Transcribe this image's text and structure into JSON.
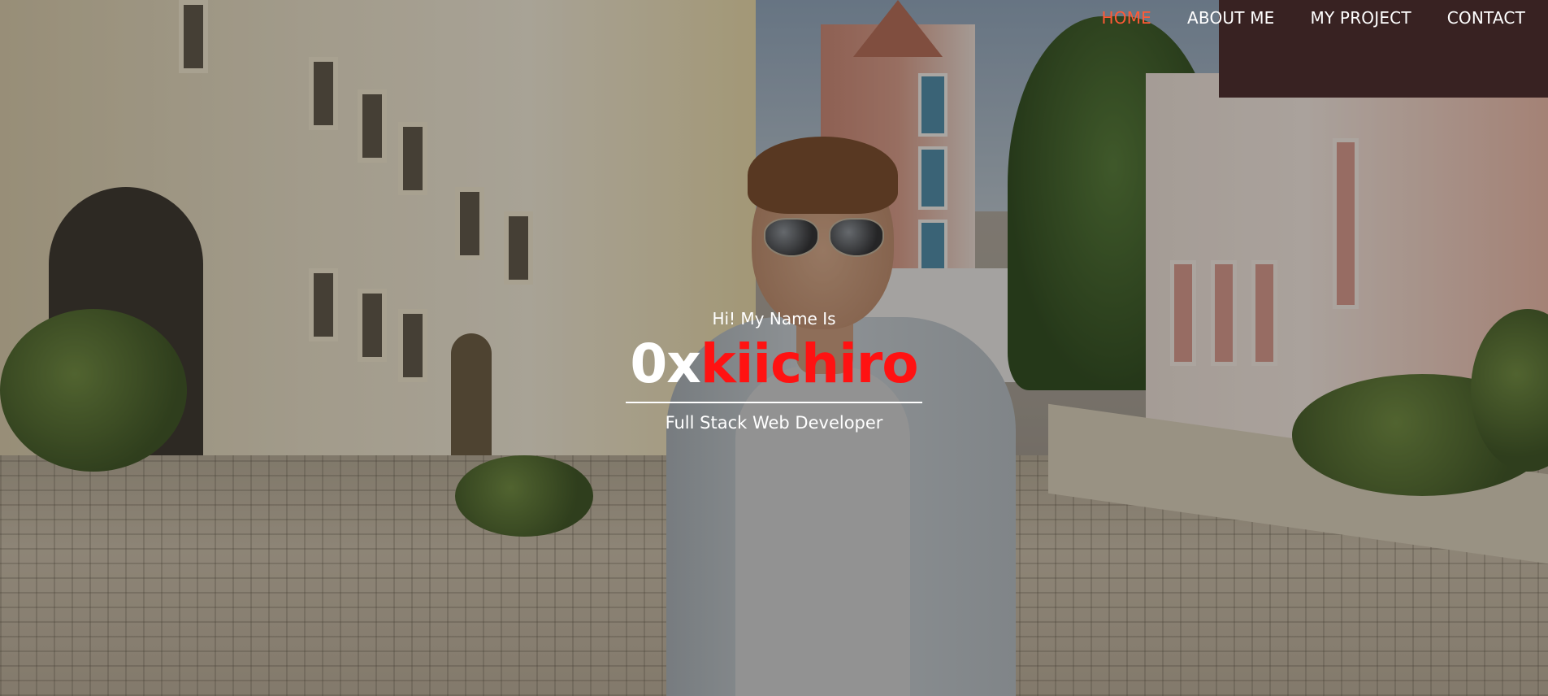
{
  "nav": {
    "items": [
      {
        "label": "HOME",
        "active": true
      },
      {
        "label": "ABOUT ME",
        "active": false
      },
      {
        "label": "MY PROJECT",
        "active": false
      },
      {
        "label": "CONTACT",
        "active": false
      }
    ],
    "active_color": "#ff5a36",
    "text_color": "#ffffff"
  },
  "intro": {
    "greeting": "Hi! My Name Is",
    "name_prefix": "0x",
    "name_highlight": "kiichiro",
    "role": "Full Stack Web Developer",
    "highlight_color": "#ff1212"
  }
}
